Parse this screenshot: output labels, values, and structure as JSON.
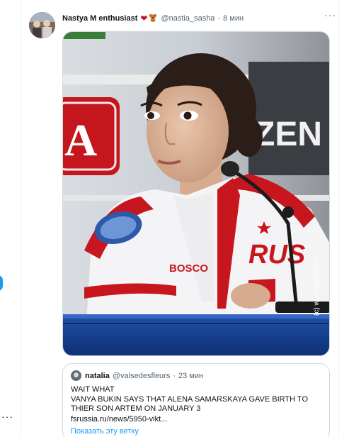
{
  "tweet": {
    "author_name": "Nastya M enthusiast",
    "emojis": [
      "heart-icon",
      "teddy-bear-icon"
    ],
    "handle": "@nastia_sasha",
    "separator": "·",
    "time": "8 мин",
    "more": "···"
  },
  "media": {
    "watermark": "(c) www.figurist.ru",
    "sign_left": "A",
    "sign_right": "ZEN",
    "jacket_logo": "BOSCO",
    "jacket_emblem": "RUS"
  },
  "quote": {
    "name": "natalia",
    "handle": "@valsedesfleurs",
    "separator": "·",
    "time": "23 мин",
    "lines": [
      "WAIT WHAT",
      "VANYA BUKIN SAYS THAT ALENA SAMARSKAYA GAVE BIRTH TO",
      "THIER SON ARTEM ON JANUARY 3"
    ],
    "link": "fsrussia.ru/news/5950-vikt...",
    "show_thread": "Показать эту ветку"
  },
  "left_rail": {
    "more": "···"
  },
  "colors": {
    "accent": "#1d9bf0",
    "text": "#0f1419",
    "muted": "#536471",
    "border": "#cfd9de"
  }
}
